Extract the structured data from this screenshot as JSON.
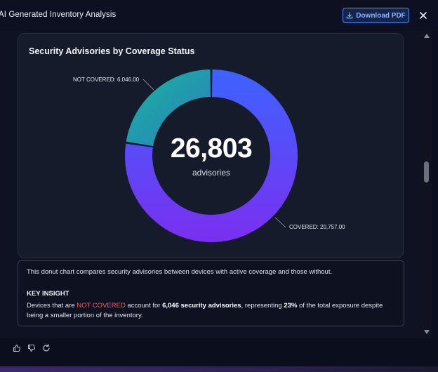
{
  "app": {
    "title": "AI Generated Inventory Analysis",
    "download_label": "Download PDF"
  },
  "icons": {
    "download": "download-icon",
    "close": "close-icon",
    "thumbs_up": "thumbs-up-icon",
    "thumbs_down": "thumbs-down-icon",
    "regenerate": "refresh-icon"
  },
  "chart_data": {
    "type": "pie",
    "title": "Security Advisories by Coverage Status",
    "center_value": "26,803",
    "center_label": "advisories",
    "slices": [
      {
        "name": "COVERED",
        "value": 20757.0,
        "label": "COVERED: 20,757.00",
        "color": "#5b3cf5"
      },
      {
        "name": "NOT COVERED",
        "value": 6046.0,
        "label": "NOT COVERED: 6,046.00",
        "color": "#1fa3a8"
      }
    ]
  },
  "insight": {
    "description": "This donut chart compares security advisories between devices with active coverage and those without.",
    "heading": "KEY INSIGHT",
    "text_1": "Devices that are ",
    "highlight": "NOT COVERED",
    "text_2": " account for ",
    "bold_1": "6,046 security advisories",
    "text_3": ", representing ",
    "bold_2": "23%",
    "text_4": " of the total exposure despite being a smaller portion of the inventory."
  },
  "colors": {
    "accent": "#4f86ff",
    "highlight_red": "#ff5b5b"
  }
}
